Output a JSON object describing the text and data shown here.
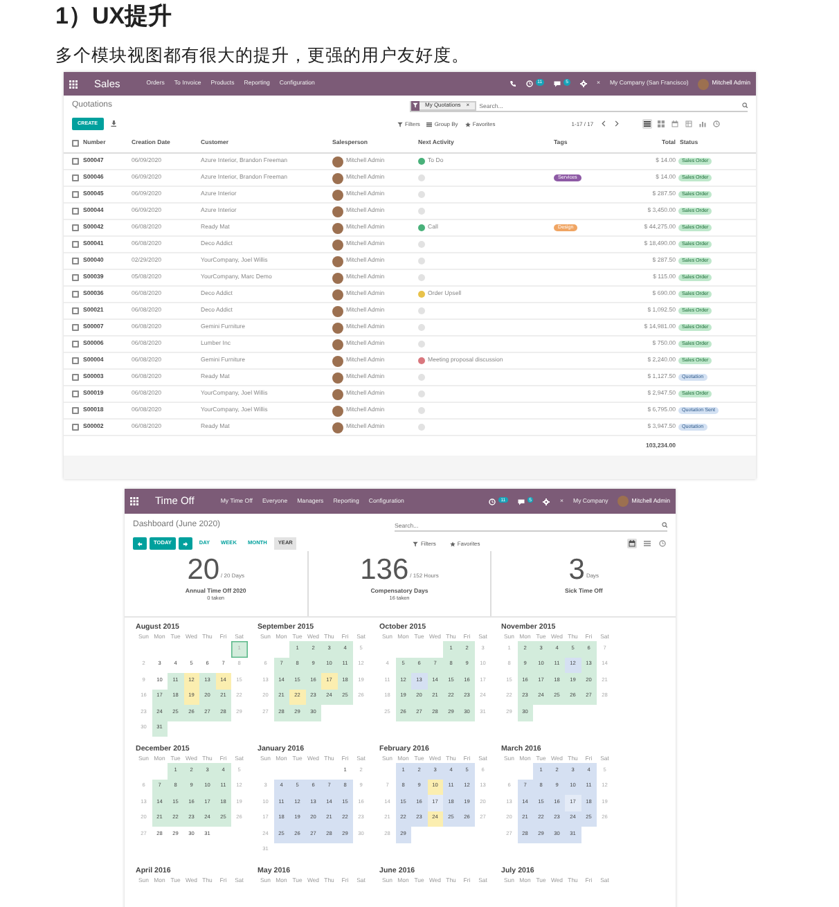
{
  "article": {
    "heading": "1）UX提升",
    "paragraph": "多个模块视图都有很大的提升，更强的用户友好度。"
  },
  "sales_screenshot": {
    "navbar": {
      "app": "Sales",
      "menu": [
        "Orders",
        "To Invoice",
        "Products",
        "Reporting",
        "Configuration"
      ],
      "activity_badge": "11",
      "message_badge": "5",
      "close": "×",
      "company": "My Company (San Francisco)",
      "user": "Mitchell Admin"
    },
    "control_panel": {
      "title": "Quotations",
      "facet": "My Quotations",
      "facet_close": "×",
      "search": {
        "placeholder": "Search..."
      },
      "create": "CREATE",
      "filters": "Filters",
      "group_by": "Group By",
      "favorites": "Favorites",
      "pager": "1-17 / 17",
      "views": [
        {
          "kind": "list",
          "selected": true
        },
        {
          "kind": "kanban",
          "selected": false
        },
        {
          "kind": "calendar",
          "selected": false
        },
        {
          "kind": "pivot",
          "selected": false
        },
        {
          "kind": "graph",
          "selected": false
        },
        {
          "kind": "activity",
          "selected": false
        }
      ]
    },
    "table": {
      "all_checked": false,
      "columns": [
        "Number",
        "Creation Date",
        "Customer",
        "Salesperson",
        "Next Activity",
        "Tags",
        "Total",
        "Status"
      ],
      "rows": [
        {
          "checked": false,
          "number": "S00047",
          "date": "06/09/2020",
          "customer": "Azure Interior, Brandon Freeman",
          "salesperson": "Mitchell Admin",
          "activity": {
            "color": "#49b17a",
            "label": "To Do"
          },
          "total": "$ 14.00",
          "status": {
            "kind": "sales_order",
            "label": "Sales Order"
          }
        },
        {
          "checked": false,
          "number": "S00046",
          "date": "06/09/2020",
          "customer": "Azure Interior, Brandon Freeman",
          "salesperson": "Mitchell Admin",
          "activity": {
            "color": "#e2e2e2"
          },
          "tag": {
            "label": "Services",
            "color": "#8e5aa5"
          },
          "total": "$ 14.00",
          "status": {
            "kind": "sales_order",
            "label": "Sales Order"
          }
        },
        {
          "checked": false,
          "number": "S00045",
          "date": "06/09/2020",
          "customer": "Azure Interior",
          "salesperson": "Mitchell Admin",
          "activity": {
            "color": "#e2e2e2"
          },
          "total": "$ 287.50",
          "status": {
            "kind": "sales_order",
            "label": "Sales Order"
          }
        },
        {
          "checked": false,
          "number": "S00044",
          "date": "06/09/2020",
          "customer": "Azure Interior",
          "salesperson": "Mitchell Admin",
          "activity": {
            "color": "#e2e2e2"
          },
          "total": "$ 3,450.00",
          "status": {
            "kind": "sales_order",
            "label": "Sales Order"
          }
        },
        {
          "checked": false,
          "number": "S00042",
          "date": "06/08/2020",
          "customer": "Ready Mat",
          "salesperson": "Mitchell Admin",
          "activity": {
            "color": "#49b17a",
            "label": "Call"
          },
          "tag": {
            "label": "Design",
            "color": "#f0a563"
          },
          "total": "$ 44,275.00",
          "status": {
            "kind": "sales_order",
            "label": "Sales Order"
          }
        },
        {
          "checked": false,
          "number": "S00041",
          "date": "06/08/2020",
          "customer": "Deco Addict",
          "salesperson": "Mitchell Admin",
          "activity": {
            "color": "#e2e2e2"
          },
          "total": "$ 18,490.00",
          "status": {
            "kind": "sales_order",
            "label": "Sales Order"
          }
        },
        {
          "checked": false,
          "number": "S00040",
          "date": "02/29/2020",
          "customer": "YourCompany, Joel Willis",
          "salesperson": "Mitchell Admin",
          "activity": {
            "color": "#e2e2e2"
          },
          "total": "$ 287.50",
          "status": {
            "kind": "sales_order",
            "label": "Sales Order"
          }
        },
        {
          "checked": false,
          "number": "S00039",
          "date": "05/08/2020",
          "customer": "YourCompany, Marc Demo",
          "salesperson": "Mitchell Admin",
          "activity": {
            "color": "#e2e2e2"
          },
          "total": "$ 115.00",
          "status": {
            "kind": "sales_order",
            "label": "Sales Order"
          }
        },
        {
          "checked": false,
          "number": "S00036",
          "date": "06/08/2020",
          "customer": "Deco Addict",
          "salesperson": "Mitchell Admin",
          "activity": {
            "color": "#e8c24a",
            "label": "Order Upsell"
          },
          "total": "$ 690.00",
          "status": {
            "kind": "sales_order",
            "label": "Sales Order"
          }
        },
        {
          "checked": false,
          "number": "S00021",
          "date": "06/08/2020",
          "customer": "Deco Addict",
          "salesperson": "Mitchell Admin",
          "activity": {
            "color": "#e2e2e2"
          },
          "total": "$ 1,092.50",
          "status": {
            "kind": "sales_order",
            "label": "Sales Order"
          }
        },
        {
          "checked": false,
          "number": "S00007",
          "date": "06/08/2020",
          "customer": "Gemini Furniture",
          "salesperson": "Mitchell Admin",
          "activity": {
            "color": "#e2e2e2"
          },
          "total": "$ 14,981.00",
          "status": {
            "kind": "sales_order",
            "label": "Sales Order"
          }
        },
        {
          "checked": false,
          "number": "S00006",
          "date": "06/08/2020",
          "customer": "Lumber Inc",
          "salesperson": "Mitchell Admin",
          "activity": {
            "color": "#e2e2e2"
          },
          "total": "$ 750.00",
          "status": {
            "kind": "sales_order",
            "label": "Sales Order"
          }
        },
        {
          "checked": false,
          "number": "S00004",
          "date": "06/08/2020",
          "customer": "Gemini Furniture",
          "salesperson": "Mitchell Admin",
          "activity": {
            "color": "#d9777e",
            "label": "Meeting proposal discussion"
          },
          "total": "$ 2,240.00",
          "status": {
            "kind": "sales_order",
            "label": "Sales Order"
          }
        },
        {
          "checked": false,
          "number": "S00003",
          "date": "06/08/2020",
          "customer": "Ready Mat",
          "salesperson": "Mitchell Admin",
          "activity": {
            "color": "#e2e2e2"
          },
          "total": "$ 1,127.50",
          "status": {
            "kind": "quotation",
            "label": "Quotation"
          }
        },
        {
          "checked": false,
          "number": "S00019",
          "date": "06/08/2020",
          "customer": "YourCompany, Joel Willis",
          "salesperson": "Mitchell Admin",
          "activity": {
            "color": "#e2e2e2"
          },
          "total": "$ 2,947.50",
          "status": {
            "kind": "sales_order",
            "label": "Sales Order"
          }
        },
        {
          "checked": false,
          "number": "S00018",
          "date": "06/08/2020",
          "customer": "YourCompany, Joel Willis",
          "salesperson": "Mitchell Admin",
          "activity": {
            "color": "#e2e2e2"
          },
          "total": "$ 6,795.00",
          "status": {
            "kind": "quotation",
            "label": "Quotation Sent"
          }
        },
        {
          "checked": false,
          "number": "S00002",
          "date": "06/08/2020",
          "customer": "Ready Mat",
          "salesperson": "Mitchell Admin",
          "activity": {
            "color": "#e2e2e2"
          },
          "total": "$ 3,947.50",
          "status": {
            "kind": "quotation",
            "label": "Quotation"
          }
        }
      ],
      "sum": "103,234.00"
    }
  },
  "timeoff_screenshot": {
    "navbar": {
      "app": "Time Off",
      "menu": [
        "My Time Off",
        "Everyone",
        "Managers",
        "Reporting",
        "Configuration"
      ],
      "activity_badge": "11",
      "message_badge": "5",
      "close": "×",
      "company": "My Company",
      "user": "Mitchell Admin"
    },
    "control_panel": {
      "title": "Dashboard (June 2020)",
      "search": {
        "placeholder": "Search..."
      },
      "today": "TODAY",
      "scales": [
        {
          "label": "DAY",
          "selected": false
        },
        {
          "label": "WEEK",
          "selected": false
        },
        {
          "label": "MONTH",
          "selected": false
        },
        {
          "label": "YEAR",
          "selected": true
        }
      ],
      "filters": "Filters",
      "favorites": "Favorites",
      "views": [
        {
          "kind": "calendar",
          "selected": true
        },
        {
          "kind": "list",
          "selected": false
        },
        {
          "kind": "activity",
          "selected": false
        }
      ]
    },
    "stats": [
      {
        "value": "20",
        "unit": "/ 20 Days",
        "name": "Annual Time Off 2020",
        "taken": "0 taken"
      },
      {
        "value": "136",
        "unit": "/ 152 Hours",
        "name": "Compensatory Days",
        "taken": "16 taken"
      },
      {
        "value": "3",
        "unit": "Days",
        "name": "Sick Time Off"
      }
    ],
    "months": [
      {
        "title": "August 2015",
        "weekdays": [
          "Sun",
          "Mon",
          "Tue",
          "Wed",
          "Thu",
          "Fri",
          "Sat"
        ],
        "weeks": [
          [
            {
              "day": "1",
              "color": "#d3ecdc",
              "outlined": true
            }
          ],
          [
            {
              "day": "2"
            },
            {
              "day": "3"
            },
            {
              "day": "4"
            },
            {
              "day": "5"
            },
            {
              "day": "6"
            },
            {
              "day": "7"
            },
            {
              "day": "8"
            }
          ],
          [
            {
              "day": "9"
            },
            {
              "day": "10"
            },
            {
              "day": "11",
              "color": "#d3ecdc"
            },
            {
              "day": "12",
              "color": "#fbeeb0"
            },
            {
              "day": "13",
              "color": "#d3ecdc"
            },
            {
              "day": "14",
              "color": "#fbeeb0"
            },
            {
              "day": "15"
            }
          ],
          [
            {
              "day": "16"
            },
            {
              "day": "17",
              "color": "#d3ecdc"
            },
            {
              "day": "18",
              "color": "#d3ecdc"
            },
            {
              "day": "19",
              "color": "#fbeeb0"
            },
            {
              "day": "20",
              "color": "#d3ecdc"
            },
            {
              "day": "21",
              "color": "#d3ecdc"
            },
            {
              "day": "22"
            }
          ],
          [
            {
              "day": "23"
            },
            {
              "day": "24",
              "color": "#d3ecdc"
            },
            {
              "day": "25",
              "color": "#d3ecdc"
            },
            {
              "day": "26",
              "color": "#d3ecdc"
            },
            {
              "day": "27",
              "color": "#d3ecdc"
            },
            {
              "day": "28",
              "color": "#d3ecdc"
            },
            {
              "day": "29"
            }
          ],
          [
            {
              "day": "30"
            },
            {
              "day": "31",
              "color": "#d3ecdc"
            }
          ]
        ]
      },
      {
        "title": "September 2015",
        "weekdays": [
          "Sun",
          "Mon",
          "Tue",
          "Wed",
          "Thu",
          "Fri",
          "Sat"
        ],
        "weeks": [
          [
            {
              "day": "1",
              "color": "#d3ecdc"
            },
            {
              "day": "2",
              "color": "#d3ecdc"
            },
            {
              "day": "3",
              "color": "#d3ecdc"
            },
            {
              "day": "4",
              "color": "#d3ecdc"
            },
            {
              "day": "5"
            }
          ],
          [
            {
              "day": "6"
            },
            {
              "day": "7",
              "color": "#d3ecdc"
            },
            {
              "day": "8",
              "color": "#d3ecdc"
            },
            {
              "day": "9",
              "color": "#d3ecdc"
            },
            {
              "day": "10",
              "color": "#d3ecdc"
            },
            {
              "day": "11",
              "color": "#d3ecdc"
            },
            {
              "day": "12"
            }
          ],
          [
            {
              "day": "13"
            },
            {
              "day": "14",
              "color": "#d3ecdc"
            },
            {
              "day": "15",
              "color": "#d3ecdc"
            },
            {
              "day": "16",
              "color": "#d3ecdc"
            },
            {
              "day": "17",
              "color": "#fbeeb0"
            },
            {
              "day": "18",
              "color": "#d3ecdc"
            },
            {
              "day": "19"
            }
          ],
          [
            {
              "day": "20"
            },
            {
              "day": "21",
              "color": "#d3ecdc"
            },
            {
              "day": "22",
              "color": "#fbeeb0"
            },
            {
              "day": "23",
              "color": "#d3ecdc"
            },
            {
              "day": "24",
              "color": "#d3ecdc"
            },
            {
              "day": "25",
              "color": "#d3ecdc"
            },
            {
              "day": "26"
            }
          ],
          [
            {
              "day": "27"
            },
            {
              "day": "28",
              "color": "#d3ecdc"
            },
            {
              "day": "29",
              "color": "#d3ecdc"
            },
            {
              "day": "30",
              "color": "#d3ecdc"
            }
          ]
        ]
      },
      {
        "title": "October 2015",
        "weekdays": [
          "Sun",
          "Mon",
          "Tue",
          "Wed",
          "Thu",
          "Fri",
          "Sat"
        ],
        "weeks": [
          [
            {
              "day": "1",
              "color": "#d3ecdc"
            },
            {
              "day": "2",
              "color": "#d3ecdc"
            },
            {
              "day": "3"
            }
          ],
          [
            {
              "day": "4"
            },
            {
              "day": "5",
              "color": "#d3ecdc"
            },
            {
              "day": "6",
              "color": "#d3ecdc"
            },
            {
              "day": "7",
              "color": "#d3ecdc"
            },
            {
              "day": "8",
              "color": "#d3ecdc"
            },
            {
              "day": "9",
              "color": "#d3ecdc"
            },
            {
              "day": "10"
            }
          ],
          [
            {
              "day": "11"
            },
            {
              "day": "12",
              "color": "#d3ecdc"
            },
            {
              "day": "13",
              "color": "#d5e0f2"
            },
            {
              "day": "14",
              "color": "#d3ecdc"
            },
            {
              "day": "15",
              "color": "#d3ecdc"
            },
            {
              "day": "16",
              "color": "#d3ecdc"
            },
            {
              "day": "17"
            }
          ],
          [
            {
              "day": "18"
            },
            {
              "day": "19",
              "color": "#d3ecdc"
            },
            {
              "day": "20",
              "color": "#d3ecdc"
            },
            {
              "day": "21",
              "color": "#d3ecdc"
            },
            {
              "day": "22",
              "color": "#d3ecdc"
            },
            {
              "day": "23",
              "color": "#d3ecdc"
            },
            {
              "day": "24"
            }
          ],
          [
            {
              "day": "25"
            },
            {
              "day": "26",
              "color": "#d3ecdc"
            },
            {
              "day": "27",
              "color": "#d3ecdc"
            },
            {
              "day": "28",
              "color": "#d3ecdc"
            },
            {
              "day": "29",
              "color": "#d3ecdc"
            },
            {
              "day": "30",
              "color": "#d3ecdc"
            },
            {
              "day": "31"
            }
          ]
        ]
      },
      {
        "title": "November 2015",
        "weekdays": [
          "Sun",
          "Mon",
          "Tue",
          "Wed",
          "Thu",
          "Fri",
          "Sat"
        ],
        "weeks": [
          [
            {
              "day": "1"
            },
            {
              "day": "2",
              "color": "#d3ecdc"
            },
            {
              "day": "3",
              "color": "#d3ecdc"
            },
            {
              "day": "4",
              "color": "#d3ecdc"
            },
            {
              "day": "5",
              "color": "#d3ecdc"
            },
            {
              "day": "6",
              "color": "#d3ecdc"
            },
            {
              "day": "7"
            }
          ],
          [
            {
              "day": "8"
            },
            {
              "day": "9",
              "color": "#d3ecdc"
            },
            {
              "day": "10",
              "color": "#d3ecdc"
            },
            {
              "day": "11",
              "color": "#d3ecdc"
            },
            {
              "day": "12",
              "color": "#d5e0f2"
            },
            {
              "day": "13",
              "color": "#d3ecdc"
            },
            {
              "day": "14"
            }
          ],
          [
            {
              "day": "15"
            },
            {
              "day": "16",
              "color": "#d3ecdc"
            },
            {
              "day": "17",
              "color": "#d3ecdc"
            },
            {
              "day": "18",
              "color": "#d3ecdc"
            },
            {
              "day": "19",
              "color": "#d3ecdc"
            },
            {
              "day": "20",
              "color": "#d3ecdc"
            },
            {
              "day": "21"
            }
          ],
          [
            {
              "day": "22"
            },
            {
              "day": "23",
              "color": "#d3ecdc"
            },
            {
              "day": "24",
              "color": "#d3ecdc"
            },
            {
              "day": "25",
              "color": "#d3ecdc"
            },
            {
              "day": "26",
              "color": "#d3ecdc"
            },
            {
              "day": "27",
              "color": "#d3ecdc"
            },
            {
              "day": "28"
            }
          ],
          [
            {
              "day": "29"
            },
            {
              "day": "30",
              "color": "#d3ecdc"
            }
          ]
        ]
      },
      {
        "title": "December 2015",
        "weekdays": [
          "Sun",
          "Mon",
          "Tue",
          "Wed",
          "Thu",
          "Fri",
          "Sat"
        ],
        "weeks": [
          [
            {
              "day": "1",
              "color": "#d3ecdc"
            },
            {
              "day": "2",
              "color": "#d3ecdc"
            },
            {
              "day": "3",
              "color": "#d3ecdc"
            },
            {
              "day": "4",
              "color": "#d3ecdc"
            },
            {
              "day": "5"
            }
          ],
          [
            {
              "day": "6"
            },
            {
              "day": "7",
              "color": "#d3ecdc"
            },
            {
              "day": "8",
              "color": "#d3ecdc"
            },
            {
              "day": "9",
              "color": "#d3ecdc"
            },
            {
              "day": "10",
              "color": "#d3ecdc"
            },
            {
              "day": "11",
              "color": "#d3ecdc"
            },
            {
              "day": "12"
            }
          ],
          [
            {
              "day": "13"
            },
            {
              "day": "14",
              "color": "#d3ecdc"
            },
            {
              "day": "15",
              "color": "#d3ecdc"
            },
            {
              "day": "16",
              "color": "#d3ecdc"
            },
            {
              "day": "17",
              "color": "#d3ecdc"
            },
            {
              "day": "18",
              "color": "#d3ecdc"
            },
            {
              "day": "19"
            }
          ],
          [
            {
              "day": "20"
            },
            {
              "day": "21",
              "color": "#d3ecdc"
            },
            {
              "day": "22",
              "color": "#d3ecdc"
            },
            {
              "day": "23",
              "color": "#d3ecdc"
            },
            {
              "day": "24",
              "color": "#d3ecdc"
            },
            {
              "day": "25",
              "color": "#d3ecdc"
            },
            {
              "day": "26"
            }
          ],
          [
            {
              "day": "27"
            },
            {
              "day": "28"
            },
            {
              "day": "29"
            },
            {
              "day": "30"
            },
            {
              "day": "31"
            }
          ]
        ]
      },
      {
        "title": "January 2016",
        "weekdays": [
          "Sun",
          "Mon",
          "Tue",
          "Wed",
          "Thu",
          "Fri",
          "Sat"
        ],
        "weeks": [
          [
            {
              "day": "1"
            },
            {
              "day": "2"
            }
          ],
          [
            {
              "day": "3"
            },
            {
              "day": "4",
              "color": "#d5e0f2"
            },
            {
              "day": "5",
              "color": "#d5e0f2"
            },
            {
              "day": "6",
              "color": "#d5e0f2"
            },
            {
              "day": "7",
              "color": "#d5e0f2"
            },
            {
              "day": "8",
              "color": "#d5e0f2"
            },
            {
              "day": "9"
            }
          ],
          [
            {
              "day": "10"
            },
            {
              "day": "11",
              "color": "#d5e0f2"
            },
            {
              "day": "12",
              "color": "#d5e0f2"
            },
            {
              "day": "13",
              "color": "#d5e0f2"
            },
            {
              "day": "14",
              "color": "#d5e0f2"
            },
            {
              "day": "15",
              "color": "#d5e0f2"
            },
            {
              "day": "16"
            }
          ],
          [
            {
              "day": "17"
            },
            {
              "day": "18",
              "color": "#d5e0f2"
            },
            {
              "day": "19",
              "color": "#d5e0f2"
            },
            {
              "day": "20",
              "color": "#d5e0f2"
            },
            {
              "day": "21",
              "color": "#d5e0f2"
            },
            {
              "day": "22",
              "color": "#d5e0f2"
            },
            {
              "day": "23"
            }
          ],
          [
            {
              "day": "24"
            },
            {
              "day": "25",
              "color": "#d5e0f2"
            },
            {
              "day": "26",
              "color": "#d5e0f2"
            },
            {
              "day": "27",
              "color": "#d5e0f2"
            },
            {
              "day": "28",
              "color": "#d5e0f2"
            },
            {
              "day": "29",
              "color": "#d5e0f2"
            },
            {
              "day": "30"
            }
          ],
          [
            {
              "day": "31"
            }
          ]
        ]
      },
      {
        "title": "February 2016",
        "weekdays": [
          "Sun",
          "Mon",
          "Tue",
          "Wed",
          "Thu",
          "Fri",
          "Sat"
        ],
        "weeks": [
          [
            {
              "day": "1",
              "color": "#d5e0f2"
            },
            {
              "day": "2",
              "color": "#d5e0f2"
            },
            {
              "day": "3",
              "color": "#d5e0f2"
            },
            {
              "day": "4",
              "color": "#d5e0f2"
            },
            {
              "day": "5",
              "color": "#d5e0f2"
            },
            {
              "day": "6"
            }
          ],
          [
            {
              "day": "7"
            },
            {
              "day": "8",
              "color": "#d5e0f2"
            },
            {
              "day": "9",
              "color": "#d5e0f2"
            },
            {
              "day": "10",
              "color": "#fbeeb0"
            },
            {
              "day": "11",
              "color": "#d5e0f2"
            },
            {
              "day": "12",
              "color": "#d5e0f2"
            },
            {
              "day": "13"
            }
          ],
          [
            {
              "day": "14"
            },
            {
              "day": "15",
              "color": "#d5e0f2"
            },
            {
              "day": "16",
              "color": "#d5e0f2"
            },
            {
              "day": "17",
              "color": "#e4ebf7"
            },
            {
              "day": "18",
              "color": "#d5e0f2"
            },
            {
              "day": "19",
              "color": "#d5e0f2"
            },
            {
              "day": "20"
            }
          ],
          [
            {
              "day": "21"
            },
            {
              "day": "22",
              "color": "#d5e0f2"
            },
            {
              "day": "23",
              "color": "#d5e0f2"
            },
            {
              "day": "24",
              "color": "#fbeeb0"
            },
            {
              "day": "25",
              "color": "#d5e0f2"
            },
            {
              "day": "26",
              "color": "#d5e0f2"
            },
            {
              "day": "27"
            }
          ],
          [
            {
              "day": "28"
            },
            {
              "day": "29",
              "color": "#d5e0f2"
            }
          ]
        ]
      },
      {
        "title": "March 2016",
        "weekdays": [
          "Sun",
          "Mon",
          "Tue",
          "Wed",
          "Thu",
          "Fri",
          "Sat"
        ],
        "weeks": [
          [
            {
              "day": "1",
              "color": "#d5e0f2"
            },
            {
              "day": "2",
              "color": "#d5e0f2"
            },
            {
              "day": "3",
              "color": "#d5e0f2"
            },
            {
              "day": "4",
              "color": "#d5e0f2"
            },
            {
              "day": "5"
            }
          ],
          [
            {
              "day": "6"
            },
            {
              "day": "7",
              "color": "#d5e0f2"
            },
            {
              "day": "8",
              "color": "#d5e0f2"
            },
            {
              "day": "9",
              "color": "#d5e0f2"
            },
            {
              "day": "10",
              "color": "#d5e0f2"
            },
            {
              "day": "11",
              "color": "#d5e0f2"
            },
            {
              "day": "12"
            }
          ],
          [
            {
              "day": "13"
            },
            {
              "day": "14",
              "color": "#d5e0f2"
            },
            {
              "day": "15",
              "color": "#d5e0f2"
            },
            {
              "day": "16",
              "color": "#d5e0f2"
            },
            {
              "day": "17",
              "color": "#e4ebf7"
            },
            {
              "day": "18",
              "color": "#d5e0f2"
            },
            {
              "day": "19"
            }
          ],
          [
            {
              "day": "20"
            },
            {
              "day": "21",
              "color": "#d5e0f2"
            },
            {
              "day": "22",
              "color": "#d5e0f2"
            },
            {
              "day": "23",
              "color": "#d5e0f2"
            },
            {
              "day": "24",
              "color": "#d5e0f2"
            },
            {
              "day": "25",
              "color": "#d5e0f2"
            },
            {
              "day": "26"
            }
          ],
          [
            {
              "day": "27"
            },
            {
              "day": "28",
              "color": "#d5e0f2"
            },
            {
              "day": "29",
              "color": "#d5e0f2"
            },
            {
              "day": "30",
              "color": "#d5e0f2"
            },
            {
              "day": "31",
              "color": "#d5e0f2"
            }
          ]
        ]
      },
      {
        "title": "April 2016",
        "weekdays": [
          "Sun",
          "Mon",
          "Tue",
          "Wed",
          "Thu",
          "Fri",
          "Sat"
        ]
      },
      {
        "title": "May 2016",
        "weekdays": [
          "Sun",
          "Mon",
          "Tue",
          "Wed",
          "Thu",
          "Fri",
          "Sat"
        ]
      },
      {
        "title": "June 2016",
        "weekdays": [
          "Sun",
          "Mon",
          "Tue",
          "Wed",
          "Thu",
          "Fri",
          "Sat"
        ]
      },
      {
        "title": "July 2016",
        "weekdays": [
          "Sun",
          "Mon",
          "Tue",
          "Wed",
          "Thu",
          "Fri",
          "Sat"
        ]
      }
    ]
  }
}
